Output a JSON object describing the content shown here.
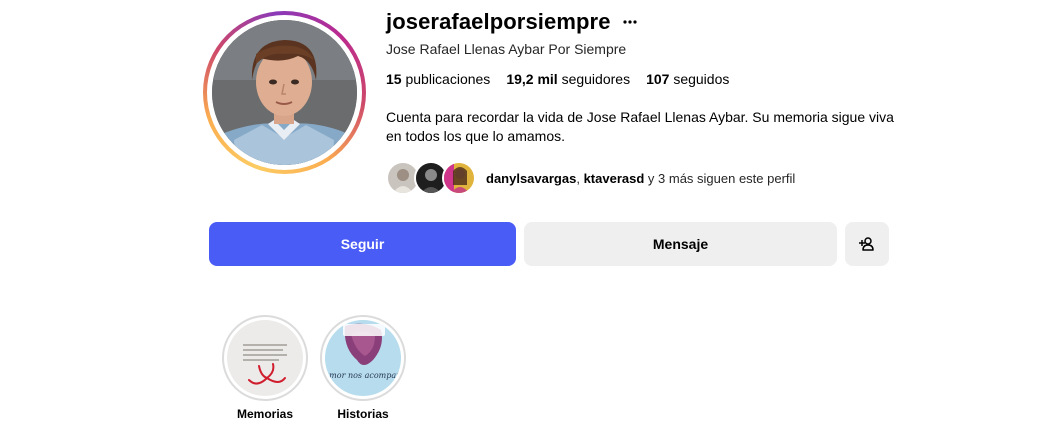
{
  "profile": {
    "username": "joserafaelporsiempre",
    "more_icon": "more-horizontal-icon",
    "full_name": "Jose Rafael Llenas Aybar Por Siempre",
    "stats": {
      "posts_count": "15",
      "posts_label": "publicaciones",
      "followers_count": "19,2 mil",
      "followers_label": "seguidores",
      "following_count": "107",
      "following_label": "seguidos"
    },
    "bio": "Cuenta para recordar la vida de Jose Rafael Llenas Aybar. Su memoria sigue viva en todos los que lo amamos.",
    "followed_by": {
      "user1": "danylsavargas",
      "separator": ", ",
      "user2": "ktaverasd",
      "rest": " y 3 más siguen este perfil"
    }
  },
  "actions": {
    "follow_label": "Seguir",
    "message_label": "Mensaje",
    "add_user_icon": "add-user-icon"
  },
  "highlights": [
    {
      "label": "Memorias"
    },
    {
      "label": "Historias",
      "image_text": "Tu amor nos acompañará"
    }
  ],
  "colors": {
    "follow_button": "#4a5cf6",
    "secondary_button": "#efefef",
    "story_ring_start": "#fccc63",
    "story_ring_end": "#bc2a8d",
    "highlight_ring": "#dbdbdb"
  }
}
